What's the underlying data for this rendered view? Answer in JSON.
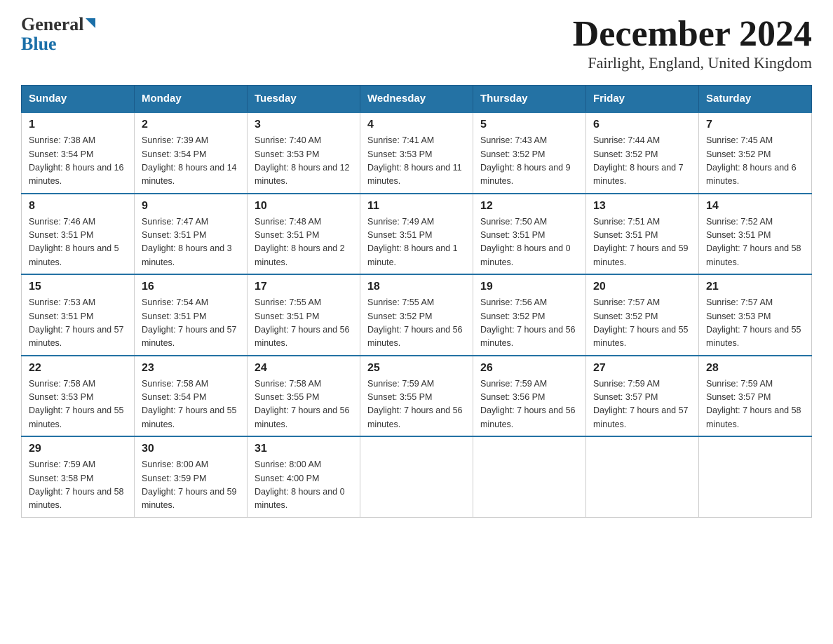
{
  "header": {
    "logo_general": "General",
    "logo_blue": "Blue",
    "month_title": "December 2024",
    "location": "Fairlight, England, United Kingdom"
  },
  "weekdays": [
    "Sunday",
    "Monday",
    "Tuesday",
    "Wednesday",
    "Thursday",
    "Friday",
    "Saturday"
  ],
  "weeks": [
    [
      {
        "day": "1",
        "sunrise": "Sunrise: 7:38 AM",
        "sunset": "Sunset: 3:54 PM",
        "daylight": "Daylight: 8 hours and 16 minutes."
      },
      {
        "day": "2",
        "sunrise": "Sunrise: 7:39 AM",
        "sunset": "Sunset: 3:54 PM",
        "daylight": "Daylight: 8 hours and 14 minutes."
      },
      {
        "day": "3",
        "sunrise": "Sunrise: 7:40 AM",
        "sunset": "Sunset: 3:53 PM",
        "daylight": "Daylight: 8 hours and 12 minutes."
      },
      {
        "day": "4",
        "sunrise": "Sunrise: 7:41 AM",
        "sunset": "Sunset: 3:53 PM",
        "daylight": "Daylight: 8 hours and 11 minutes."
      },
      {
        "day": "5",
        "sunrise": "Sunrise: 7:43 AM",
        "sunset": "Sunset: 3:52 PM",
        "daylight": "Daylight: 8 hours and 9 minutes."
      },
      {
        "day": "6",
        "sunrise": "Sunrise: 7:44 AM",
        "sunset": "Sunset: 3:52 PM",
        "daylight": "Daylight: 8 hours and 7 minutes."
      },
      {
        "day": "7",
        "sunrise": "Sunrise: 7:45 AM",
        "sunset": "Sunset: 3:52 PM",
        "daylight": "Daylight: 8 hours and 6 minutes."
      }
    ],
    [
      {
        "day": "8",
        "sunrise": "Sunrise: 7:46 AM",
        "sunset": "Sunset: 3:51 PM",
        "daylight": "Daylight: 8 hours and 5 minutes."
      },
      {
        "day": "9",
        "sunrise": "Sunrise: 7:47 AM",
        "sunset": "Sunset: 3:51 PM",
        "daylight": "Daylight: 8 hours and 3 minutes."
      },
      {
        "day": "10",
        "sunrise": "Sunrise: 7:48 AM",
        "sunset": "Sunset: 3:51 PM",
        "daylight": "Daylight: 8 hours and 2 minutes."
      },
      {
        "day": "11",
        "sunrise": "Sunrise: 7:49 AM",
        "sunset": "Sunset: 3:51 PM",
        "daylight": "Daylight: 8 hours and 1 minute."
      },
      {
        "day": "12",
        "sunrise": "Sunrise: 7:50 AM",
        "sunset": "Sunset: 3:51 PM",
        "daylight": "Daylight: 8 hours and 0 minutes."
      },
      {
        "day": "13",
        "sunrise": "Sunrise: 7:51 AM",
        "sunset": "Sunset: 3:51 PM",
        "daylight": "Daylight: 7 hours and 59 minutes."
      },
      {
        "day": "14",
        "sunrise": "Sunrise: 7:52 AM",
        "sunset": "Sunset: 3:51 PM",
        "daylight": "Daylight: 7 hours and 58 minutes."
      }
    ],
    [
      {
        "day": "15",
        "sunrise": "Sunrise: 7:53 AM",
        "sunset": "Sunset: 3:51 PM",
        "daylight": "Daylight: 7 hours and 57 minutes."
      },
      {
        "day": "16",
        "sunrise": "Sunrise: 7:54 AM",
        "sunset": "Sunset: 3:51 PM",
        "daylight": "Daylight: 7 hours and 57 minutes."
      },
      {
        "day": "17",
        "sunrise": "Sunrise: 7:55 AM",
        "sunset": "Sunset: 3:51 PM",
        "daylight": "Daylight: 7 hours and 56 minutes."
      },
      {
        "day": "18",
        "sunrise": "Sunrise: 7:55 AM",
        "sunset": "Sunset: 3:52 PM",
        "daylight": "Daylight: 7 hours and 56 minutes."
      },
      {
        "day": "19",
        "sunrise": "Sunrise: 7:56 AM",
        "sunset": "Sunset: 3:52 PM",
        "daylight": "Daylight: 7 hours and 56 minutes."
      },
      {
        "day": "20",
        "sunrise": "Sunrise: 7:57 AM",
        "sunset": "Sunset: 3:52 PM",
        "daylight": "Daylight: 7 hours and 55 minutes."
      },
      {
        "day": "21",
        "sunrise": "Sunrise: 7:57 AM",
        "sunset": "Sunset: 3:53 PM",
        "daylight": "Daylight: 7 hours and 55 minutes."
      }
    ],
    [
      {
        "day": "22",
        "sunrise": "Sunrise: 7:58 AM",
        "sunset": "Sunset: 3:53 PM",
        "daylight": "Daylight: 7 hours and 55 minutes."
      },
      {
        "day": "23",
        "sunrise": "Sunrise: 7:58 AM",
        "sunset": "Sunset: 3:54 PM",
        "daylight": "Daylight: 7 hours and 55 minutes."
      },
      {
        "day": "24",
        "sunrise": "Sunrise: 7:58 AM",
        "sunset": "Sunset: 3:55 PM",
        "daylight": "Daylight: 7 hours and 56 minutes."
      },
      {
        "day": "25",
        "sunrise": "Sunrise: 7:59 AM",
        "sunset": "Sunset: 3:55 PM",
        "daylight": "Daylight: 7 hours and 56 minutes."
      },
      {
        "day": "26",
        "sunrise": "Sunrise: 7:59 AM",
        "sunset": "Sunset: 3:56 PM",
        "daylight": "Daylight: 7 hours and 56 minutes."
      },
      {
        "day": "27",
        "sunrise": "Sunrise: 7:59 AM",
        "sunset": "Sunset: 3:57 PM",
        "daylight": "Daylight: 7 hours and 57 minutes."
      },
      {
        "day": "28",
        "sunrise": "Sunrise: 7:59 AM",
        "sunset": "Sunset: 3:57 PM",
        "daylight": "Daylight: 7 hours and 58 minutes."
      }
    ],
    [
      {
        "day": "29",
        "sunrise": "Sunrise: 7:59 AM",
        "sunset": "Sunset: 3:58 PM",
        "daylight": "Daylight: 7 hours and 58 minutes."
      },
      {
        "day": "30",
        "sunrise": "Sunrise: 8:00 AM",
        "sunset": "Sunset: 3:59 PM",
        "daylight": "Daylight: 7 hours and 59 minutes."
      },
      {
        "day": "31",
        "sunrise": "Sunrise: 8:00 AM",
        "sunset": "Sunset: 4:00 PM",
        "daylight": "Daylight: 8 hours and 0 minutes."
      },
      null,
      null,
      null,
      null
    ]
  ]
}
